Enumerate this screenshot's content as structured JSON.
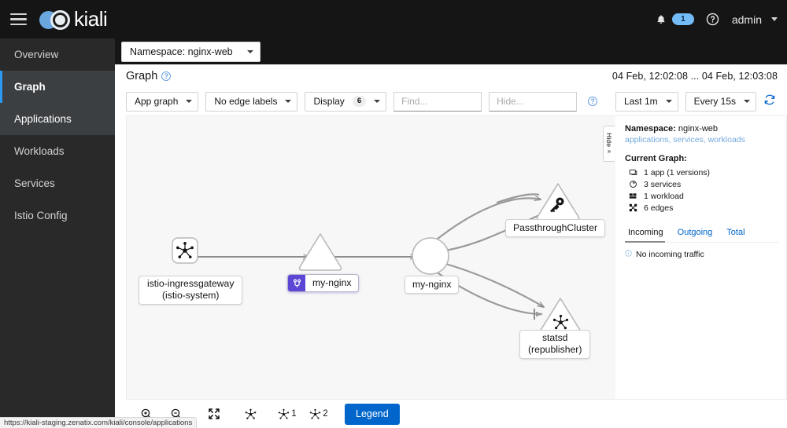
{
  "masthead": {
    "brand": "kiali",
    "menu_icon": "hamburger-icon",
    "notification_count": "1",
    "help_label": "?",
    "user": "admin"
  },
  "sidebar": {
    "items": [
      {
        "label": "Overview",
        "state": "default"
      },
      {
        "label": "Graph",
        "state": "active"
      },
      {
        "label": "Applications",
        "state": "hover"
      },
      {
        "label": "Workloads",
        "state": "default"
      },
      {
        "label": "Services",
        "state": "default"
      },
      {
        "label": "Istio Config",
        "state": "default"
      }
    ]
  },
  "namespace_bar": {
    "selector_label": "Namespace: nginx-web"
  },
  "page_header": {
    "title": "Graph",
    "time_range": "04 Feb, 12:02:08 ... 04 Feb, 12:03:08"
  },
  "toolbar": {
    "graph_type": "App graph",
    "edge_labels": "No edge labels",
    "display_label": "Display",
    "display_count": "6",
    "find_placeholder": "Find...",
    "hide_placeholder": "Hide...",
    "find_value": "",
    "hide_value": "",
    "duration": "Last 1m",
    "refresh_interval": "Every 15s",
    "refresh_icon": "refresh-icon"
  },
  "graph": {
    "nodes": [
      {
        "id": "istio-ingressgateway",
        "label_line1": "istio-ingressgateway",
        "label_line2": "(istio-system)",
        "shape": "rounded-square",
        "icon": "mesh-icon"
      },
      {
        "id": "my-nginx-service",
        "label_line1": "my-nginx",
        "label_line2": "",
        "shape": "triangle",
        "icon": "virtual-service-icon",
        "badge": "virtual-service"
      },
      {
        "id": "my-nginx-app",
        "label_line1": "my-nginx",
        "label_line2": "",
        "shape": "circle",
        "icon": ""
      },
      {
        "id": "passthroughcluster",
        "label_line1": "PassthroughCluster",
        "label_line2": "",
        "shape": "triangle",
        "icon": "key-icon"
      },
      {
        "id": "statsd",
        "label_line1": "statsd",
        "label_line2": "(republisher)",
        "shape": "triangle",
        "icon": "mesh-icon"
      }
    ]
  },
  "side_panel": {
    "hide_tab_label": "Hide",
    "namespace_prefix": "Namespace:",
    "namespace_value": "nginx-web",
    "links": "applications, services, workloads",
    "current_graph_title": "Current Graph:",
    "stats": [
      {
        "icon": "app-icon",
        "text": "1 app (1 versions)"
      },
      {
        "icon": "service-icon",
        "text": "3 services"
      },
      {
        "icon": "workload-icon",
        "text": "1 workload"
      },
      {
        "icon": "edge-icon",
        "text": "6 edges"
      }
    ],
    "tabs": [
      {
        "label": "Incoming",
        "active": true
      },
      {
        "label": "Outgoing",
        "active": false
      },
      {
        "label": "Total",
        "active": false
      }
    ],
    "notice": "No incoming traffic"
  },
  "bottom_bar": {
    "zoom_in": "zoom-in-icon",
    "zoom_out": "zoom-out-icon",
    "fit_screen": "fit-to-screen-icon",
    "layout_default": "layout-dagre-icon",
    "layout_1_count": "1",
    "layout_2_count": "2",
    "legend_label": "Legend"
  },
  "status_bar": {
    "url": "https://kiali-staging.zenatix.com/kiali/console/applications"
  }
}
